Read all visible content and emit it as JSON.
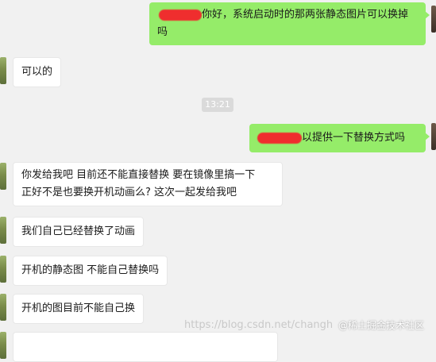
{
  "messages": [
    {
      "side": "right",
      "text_line1": "你好，系统启动时的那两张静态图片可以换掉",
      "text_line2": "吗"
    },
    {
      "side": "left",
      "text": "可以的"
    },
    {
      "side": "right",
      "text": "以提供一下替换方式吗"
    },
    {
      "side": "left",
      "text_line1": "你发给我吧 目前还不能直接替换 要在镜像里搞一下",
      "text_line2": "正好不是也要换开机动画么? 这次一起发给我吧"
    },
    {
      "side": "left",
      "text": "我们自己已经替换了动画"
    },
    {
      "side": "left",
      "text": "开机的静态图  不能自己替换吗"
    },
    {
      "side": "left",
      "text": "开机的图目前不能自己换"
    }
  ],
  "time_divider": "13:21",
  "watermark": {
    "url": "https://blog.csdn.net/changh",
    "platform": "@稀土掘金技术社区"
  },
  "colors": {
    "background": "#f1f1f1",
    "bubble_self": "#95ec69",
    "bubble_other": "#ffffff",
    "redaction": "#ef2e2e"
  }
}
